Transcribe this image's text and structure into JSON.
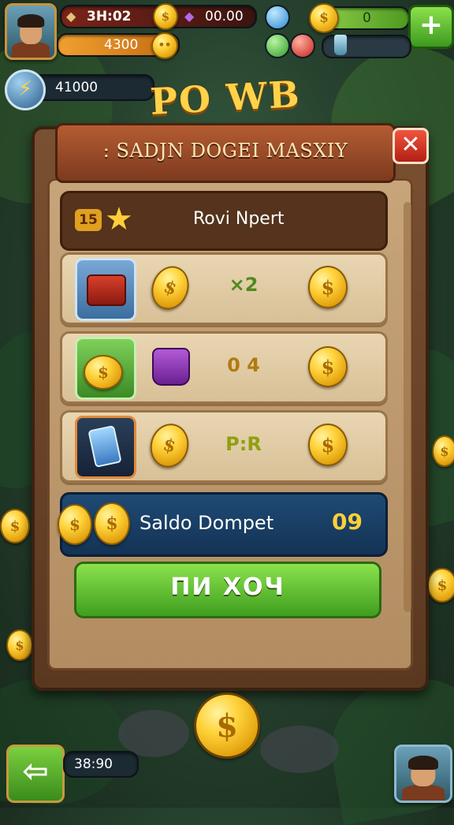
{
  "hud": {
    "timer": "3H:02",
    "gems": "00.00",
    "xp_value": "4300",
    "coins_counter": "0",
    "power_value": "41000"
  },
  "logo": "PO WB",
  "dialog": {
    "title": ": SADJN DOGEI MASXIY",
    "close_glyph": "✕",
    "rank_badge": "15",
    "rank_label": "Rovi Npert",
    "rows": [
      {
        "value": "×2",
        "value_color": "#4f8a1f"
      },
      {
        "value": "0 4",
        "value_color": "#b07b10"
      },
      {
        "value": "P:R",
        "value_color": "#8fa010"
      }
    ],
    "balance_label": "Saldo Dompet",
    "balance_value": "09",
    "action_label": "ПИ ХОЧ"
  },
  "footer": {
    "time": "38:90",
    "back_glyph": "⇦"
  },
  "colors": {
    "accent_gold": "#ffd24a",
    "panel_brown": "#7a5032",
    "action_green": "#5cbf2a",
    "balance_blue": "#1f4a74"
  }
}
